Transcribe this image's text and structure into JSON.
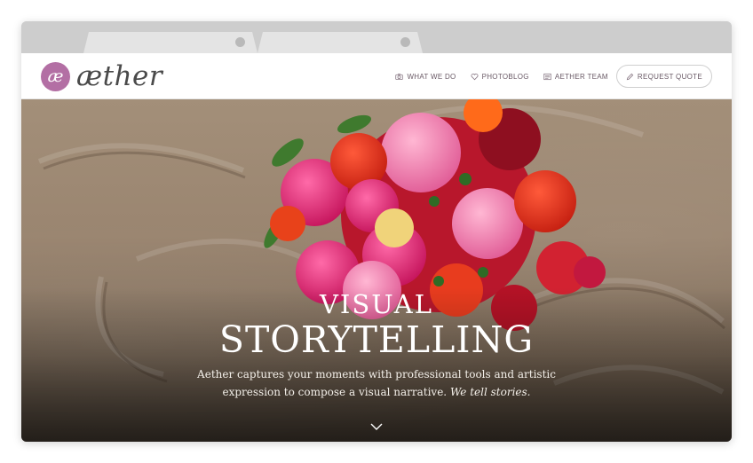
{
  "header": {
    "logo_mark": "æ",
    "logo_word": "æther"
  },
  "nav": {
    "items": [
      {
        "label": "WHAT WE DO",
        "icon": "camera-icon"
      },
      {
        "label": "PHOTOBLOG",
        "icon": "heart-icon"
      },
      {
        "label": "AETHER TEAM",
        "icon": "id-card-icon"
      }
    ],
    "quote_label": "REQUEST QUOTE",
    "quote_icon": "pencil-icon"
  },
  "hero": {
    "title_small": "VISUAL",
    "title_big": "STORYTELLING",
    "subtitle_main": "Aether captures your moments with professional tools and artistic expression to compose a visual narrative.",
    "subtitle_em": "We tell stories.",
    "scroll_icon": "chevron-down-icon"
  },
  "colors": {
    "brand": "#b36fa4",
    "nav_text": "#6a5a66"
  }
}
